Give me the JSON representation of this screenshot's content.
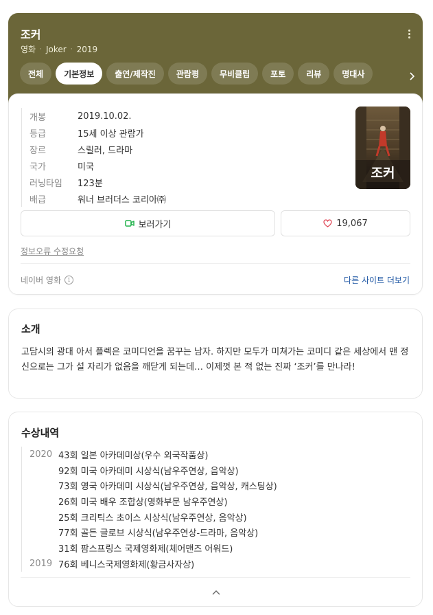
{
  "header": {
    "title": "조커",
    "meta": [
      "영화",
      "Joker",
      "2019"
    ],
    "accent_color": "#6b6639",
    "tabs": [
      {
        "label": "전체"
      },
      {
        "label": "기본정보",
        "active": true
      },
      {
        "label": "출연/제작진"
      },
      {
        "label": "관람평"
      },
      {
        "label": "무비클립"
      },
      {
        "label": "포토"
      },
      {
        "label": "리뷰"
      },
      {
        "label": "명대사"
      }
    ]
  },
  "info": {
    "rows": [
      {
        "label": "개봉",
        "value": "2019.10.02."
      },
      {
        "label": "등급",
        "value": "15세 이상 관람가"
      },
      {
        "label": "장르",
        "value": "스릴러, 드라마"
      },
      {
        "label": "국가",
        "value": "미국"
      },
      {
        "label": "러닝타임",
        "value": "123분"
      },
      {
        "label": "배급",
        "value": "워너 브러더스 코리아㈜"
      }
    ],
    "poster_title": "조커",
    "watch_label": "보러가기",
    "like_count": "19,067",
    "report_label": "정보오류 수정요청",
    "source_label": "네이버 영화",
    "info_icon_glyph": "i",
    "other_sites_label": "다른 사이트 더보기"
  },
  "intro": {
    "title": "소개",
    "text": "고담시의 광대 아서 플렉은 코미디언을 꿈꾸는 남자. 하지만 모두가 미쳐가는 코미디 같은 세상에서 맨 정신으로는 그가 설 자리가 없음을 깨닫게 되는데… 이제껏 본 적 없는 진짜 ‘조커’를 만나라!"
  },
  "awards": {
    "title": "수상내역",
    "rows": [
      {
        "year": "2020",
        "text": "43회 일본 아카데미상(우수 외국작품상)"
      },
      {
        "year": "",
        "text": "92회 미국 아카데미 시상식(남우주연상, 음악상)"
      },
      {
        "year": "",
        "text": "73회 영국 아카데미 시상식(남우주연상, 음악상, 캐스팅상)"
      },
      {
        "year": "",
        "text": "26회 미국 배우 조합상(영화부문 남우주연상)"
      },
      {
        "year": "",
        "text": "25회 크리틱스 초이스 시상식(남우주연상, 음악상)"
      },
      {
        "year": "",
        "text": "77회 골든 글로브 시상식(남우주연상-드라마, 음악상)"
      },
      {
        "year": "",
        "text": "31회 팜스프링스 국제영화제(체어맨즈 어워드)"
      },
      {
        "year": "2019",
        "text": "76회 베니스국제영화제(황금사자상)"
      }
    ]
  },
  "icons": {
    "more": "more-vertical-icon",
    "tab_next": "chevron-right-icon",
    "watch": "video-camera-icon",
    "like": "heart-icon",
    "info": "info-circle-icon",
    "collapse": "chevron-up-icon"
  }
}
